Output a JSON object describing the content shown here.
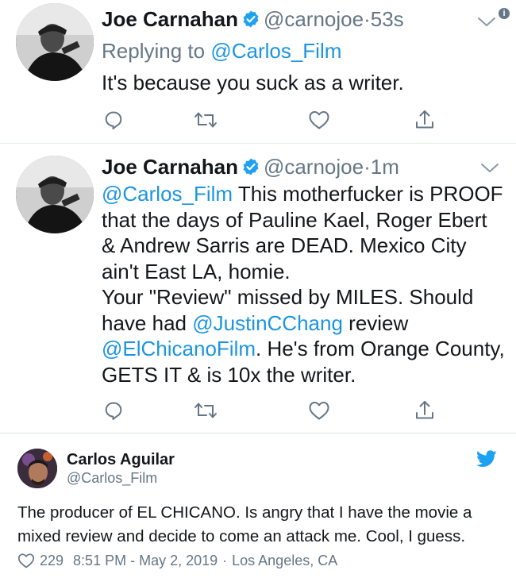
{
  "tweets": [
    {
      "name": "Joe Carnahan",
      "handle": "@carnojoe",
      "dot": "·",
      "time": "53s",
      "replying_prefix": "Replying to ",
      "replying_to": "@Carlos_Film",
      "text": "It's because you suck as a writer."
    },
    {
      "name": "Joe Carnahan",
      "handle": "@carnojoe",
      "dot": "·",
      "time": "1m",
      "body": {
        "mention1": "@Carlos_Film",
        "seg1": " This motherfucker is PROOF that the days of Pauline Kael, Roger Ebert & Andrew Sarris are DEAD. Mexico City ain't East LA, homie.",
        "seg2": "Your \"Review\" missed by MILES. Should have had ",
        "mention2": "@JustinCChang",
        "seg3": " review ",
        "mention3": "@ElChicanoFilm",
        "seg4": ". He's from Orange County, GETS IT & is 10x the writer."
      }
    }
  ],
  "info_badge": "i",
  "embedded": {
    "name": "Carlos Aguilar",
    "handle": "@Carlos_Film",
    "text": "The producer of EL CHICANO. Is angry that I have the movie a mixed review and decide to come an attack me. Cool, I guess.",
    "likes": "229",
    "timestamp": "8:51 PM - May 2, 2019",
    "sep": "·",
    "location": "Los Angeles, CA"
  },
  "colors": {
    "link": "#1b95e0",
    "secondary": "#657786",
    "verified": "#1da1f2",
    "primary": "#14171a"
  },
  "icons": [
    "verified-icon",
    "chevron-down-icon",
    "reply-icon",
    "retweet-icon",
    "like-icon",
    "share-icon",
    "twitter-bird-icon",
    "heart-icon"
  ]
}
